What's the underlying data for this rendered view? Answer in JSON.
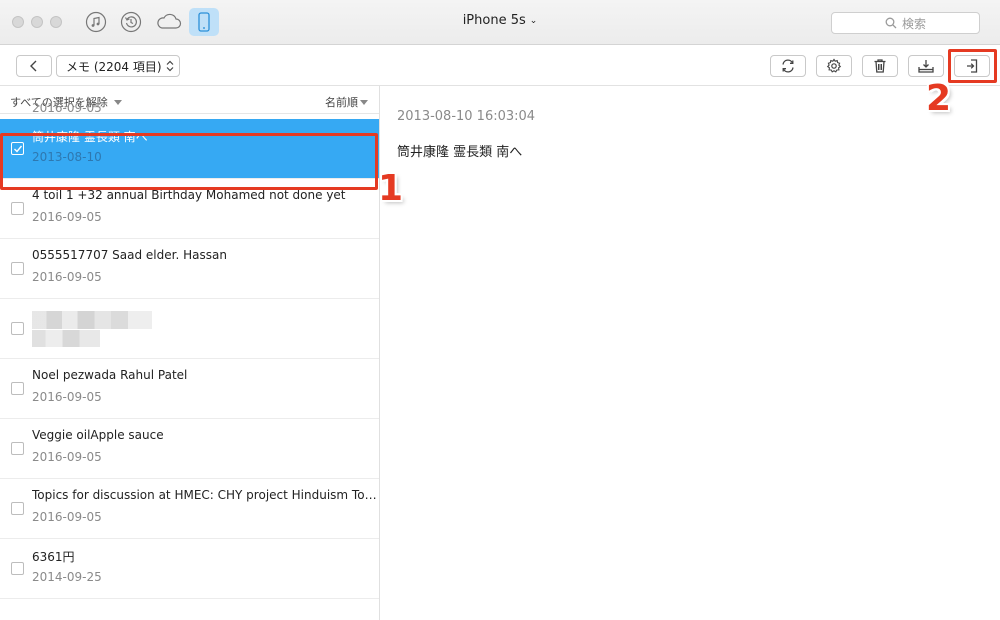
{
  "window": {
    "device_name": "iPhone 5s",
    "nav_icons": [
      "music-icon",
      "history-icon",
      "cloud-icon",
      "phone-icon"
    ],
    "search_placeholder": "検索"
  },
  "toolbar": {
    "category_select": "メモ (2204 項目)",
    "tools": [
      "refresh-icon",
      "settings-icon",
      "trash-icon",
      "export-to-computer-icon",
      "import-to-device-icon"
    ]
  },
  "list": {
    "deselect_all": "すべての選択を解除",
    "sort_label": "名前順",
    "partial_top_date": "2016-09-05",
    "rows": [
      {
        "title": "筒井康隆  霊長類 南へ",
        "date": "2013-08-10",
        "selected": true
      },
      {
        "title": "4 toil 1 +32 annual Birthday Mohamed not done yet",
        "date": "2016-09-05",
        "selected": false
      },
      {
        "title": "0555517707 Saad elder. Hassan",
        "date": "2016-09-05",
        "selected": false
      },
      {
        "title": "",
        "date": "",
        "selected": false,
        "blurred": true
      },
      {
        "title": "Noel pezwada Rahul Patel",
        "date": "2016-09-05",
        "selected": false
      },
      {
        "title": "Veggie oilApple sauce",
        "date": "2016-09-05",
        "selected": false
      },
      {
        "title": "Topics for discussion at HMEC: CHY project Hinduism Topics",
        "date": "2016-09-05",
        "selected": false
      },
      {
        "title": "6361円",
        "date": "2014-09-25",
        "selected": false
      }
    ]
  },
  "detail": {
    "date": "2013-08-10 16:03:04",
    "content": "筒井康隆  霊長類 南へ"
  },
  "annotations": {
    "step1": "1",
    "step2": "2",
    "highlight_color": "#e53a22"
  },
  "colors": {
    "selection": "#36a9f3",
    "active_tab": "#bfe0f8"
  }
}
